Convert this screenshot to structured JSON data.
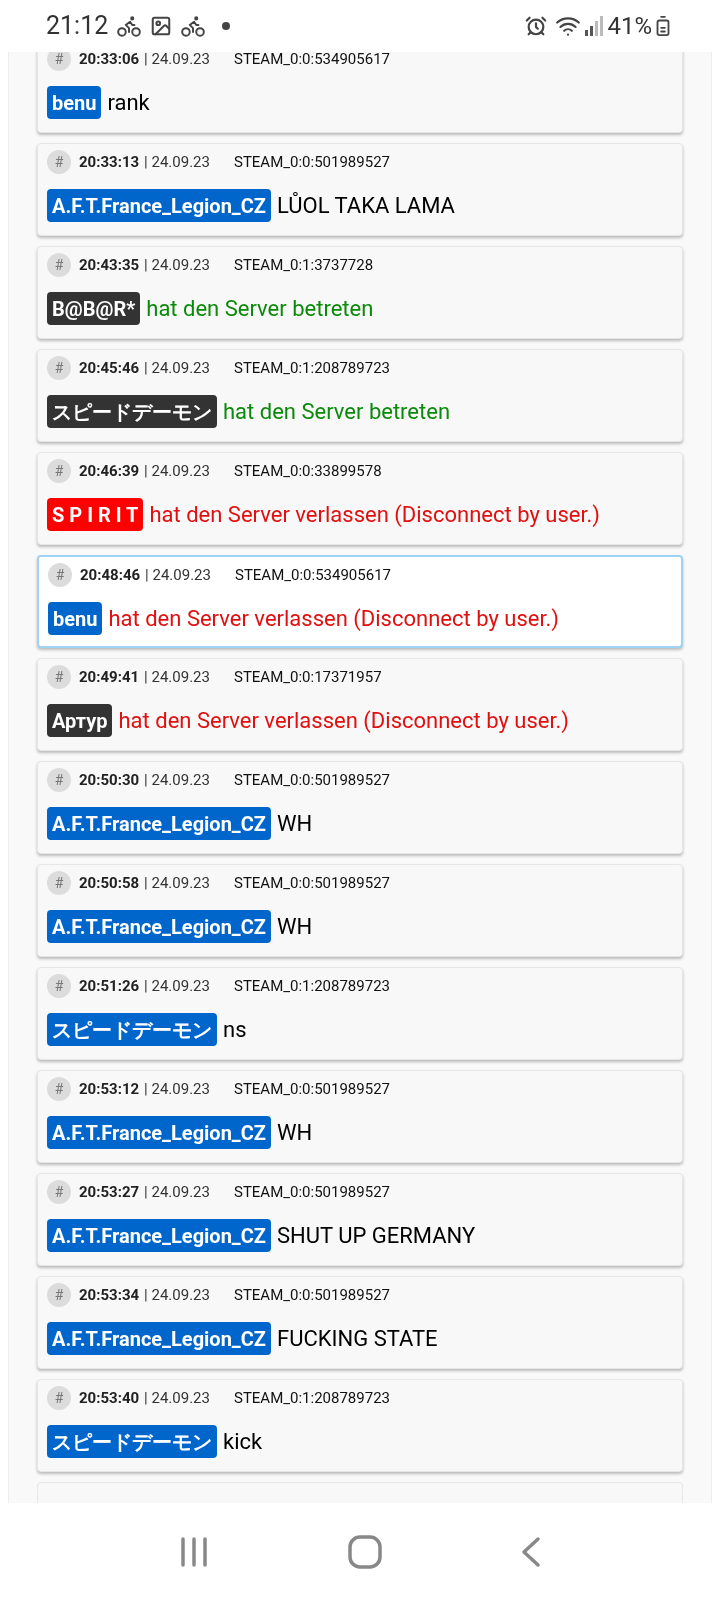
{
  "status_bar": {
    "time": "21:12",
    "battery": "41%"
  },
  "log": [
    {
      "hash": "#",
      "time": "20:33:06",
      "date": "| 24.09.23",
      "steam_id": "STEAM_0:0:534905617",
      "player": "benu",
      "color": "#0066cc",
      "kind": "chat",
      "message": "rank",
      "selected": false
    },
    {
      "hash": "#",
      "time": "20:33:13",
      "date": "| 24.09.23",
      "steam_id": "STEAM_0:0:501989527",
      "player": "A.F.T.France_Legion_CZ",
      "color": "#0066cc",
      "kind": "chat",
      "message": "LŮOL TAKA LAMA",
      "selected": false
    },
    {
      "hash": "#",
      "time": "20:43:35",
      "date": "| 24.09.23",
      "steam_id": "STEAM_0:1:3737728",
      "player": "B@B@R*",
      "color": "#333333",
      "kind": "join",
      "message": "hat den Server betreten",
      "selected": false
    },
    {
      "hash": "#",
      "time": "20:45:46",
      "date": "| 24.09.23",
      "steam_id": "STEAM_0:1:208789723",
      "player": "スピードデーモン",
      "color": "#333333",
      "kind": "join",
      "message": "hat den Server betreten",
      "selected": false
    },
    {
      "hash": "#",
      "time": "20:46:39",
      "date": "| 24.09.23",
      "steam_id": "STEAM_0:0:33899578",
      "player": "S P I R I T",
      "color": "#ff0000",
      "kind": "leave",
      "message": "hat den Server verlassen (Disconnect by user.)",
      "selected": false
    },
    {
      "hash": "#",
      "time": "20:48:46",
      "date": "| 24.09.23",
      "steam_id": "STEAM_0:0:534905617",
      "player": "benu",
      "color": "#0066cc",
      "kind": "leave",
      "message": "hat den Server verlassen (Disconnect by user.)",
      "selected": true
    },
    {
      "hash": "#",
      "time": "20:49:41",
      "date": "| 24.09.23",
      "steam_id": "STEAM_0:0:17371957",
      "player": "Артур",
      "color": "#333333",
      "kind": "leave",
      "message": "hat den Server verlassen (Disconnect by user.)",
      "selected": false
    },
    {
      "hash": "#",
      "time": "20:50:30",
      "date": "| 24.09.23",
      "steam_id": "STEAM_0:0:501989527",
      "player": "A.F.T.France_Legion_CZ",
      "color": "#0066cc",
      "kind": "chat",
      "message": "WH",
      "selected": false
    },
    {
      "hash": "#",
      "time": "20:50:58",
      "date": "| 24.09.23",
      "steam_id": "STEAM_0:0:501989527",
      "player": "A.F.T.France_Legion_CZ",
      "color": "#0066cc",
      "kind": "chat",
      "message": "WH",
      "selected": false
    },
    {
      "hash": "#",
      "time": "20:51:26",
      "date": "| 24.09.23",
      "steam_id": "STEAM_0:1:208789723",
      "player": "スピードデーモン",
      "color": "#0066cc",
      "kind": "chat",
      "message": "ns",
      "selected": false
    },
    {
      "hash": "#",
      "time": "20:53:12",
      "date": "| 24.09.23",
      "steam_id": "STEAM_0:0:501989527",
      "player": "A.F.T.France_Legion_CZ",
      "color": "#0066cc",
      "kind": "chat",
      "message": "WH",
      "selected": false
    },
    {
      "hash": "#",
      "time": "20:53:27",
      "date": "| 24.09.23",
      "steam_id": "STEAM_0:0:501989527",
      "player": "A.F.T.France_Legion_CZ",
      "color": "#0066cc",
      "kind": "chat",
      "message": "SHUT UP GERMANY",
      "selected": false
    },
    {
      "hash": "#",
      "time": "20:53:34",
      "date": "| 24.09.23",
      "steam_id": "STEAM_0:0:501989527",
      "player": "A.F.T.France_Legion_CZ",
      "color": "#0066cc",
      "kind": "chat",
      "message": "FUCKING STATE",
      "selected": false
    },
    {
      "hash": "#",
      "time": "20:53:40",
      "date": "| 24.09.23",
      "steam_id": "STEAM_0:1:208789723",
      "player": "スピードデーモン",
      "color": "#0066cc",
      "kind": "chat",
      "message": "kick",
      "selected": false
    }
  ]
}
